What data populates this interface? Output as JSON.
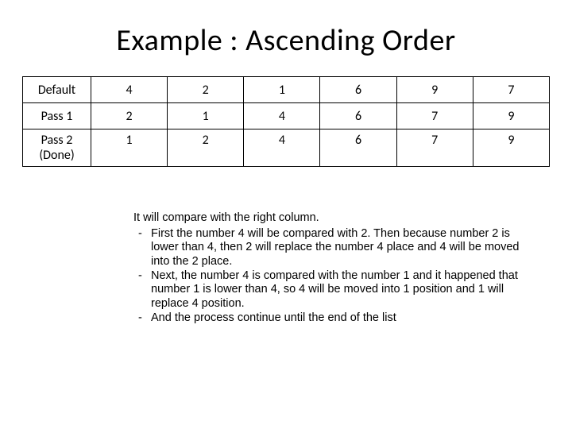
{
  "title": "Example : Ascending Order",
  "chart_data": {
    "type": "table",
    "columns": [
      "",
      "c1",
      "c2",
      "c3",
      "c4",
      "c5",
      "c6"
    ],
    "rows": [
      {
        "label": "Default",
        "values": [
          4,
          2,
          1,
          6,
          9,
          7
        ]
      },
      {
        "label": "Pass 1",
        "values": [
          2,
          1,
          4,
          6,
          7,
          9
        ]
      },
      {
        "label": "Pass 2 (Done)",
        "values": [
          1,
          2,
          4,
          6,
          7,
          9
        ]
      }
    ]
  },
  "table": {
    "row0": {
      "label": "Default",
      "c1": "4",
      "c2": "2",
      "c3": "1",
      "c4": "6",
      "c5": "9",
      "c6": "7"
    },
    "row1": {
      "label": "Pass 1",
      "c1": "2",
      "c2": "1",
      "c3": "4",
      "c4": "6",
      "c5": "7",
      "c6": "9"
    },
    "row2": {
      "label": "Pass 2 (Done)",
      "c1": "1",
      "c2": "2",
      "c3": "4",
      "c4": "6",
      "c5": "7",
      "c6": "9"
    }
  },
  "description": {
    "intro": "It will compare with the right column.",
    "points": {
      "p1": "First the number 4 will be compared with 2. Then because number 2 is lower than 4, then 2 will replace the number 4 place and 4 will be moved into the 2 place.",
      "p2": "Next, the number 4 is compared with the number 1 and it happened that number 1 is lower than 4, so 4 will be moved into 1 position and 1 will replace 4 position.",
      "p3": "And the process continue until the end of the list"
    }
  }
}
